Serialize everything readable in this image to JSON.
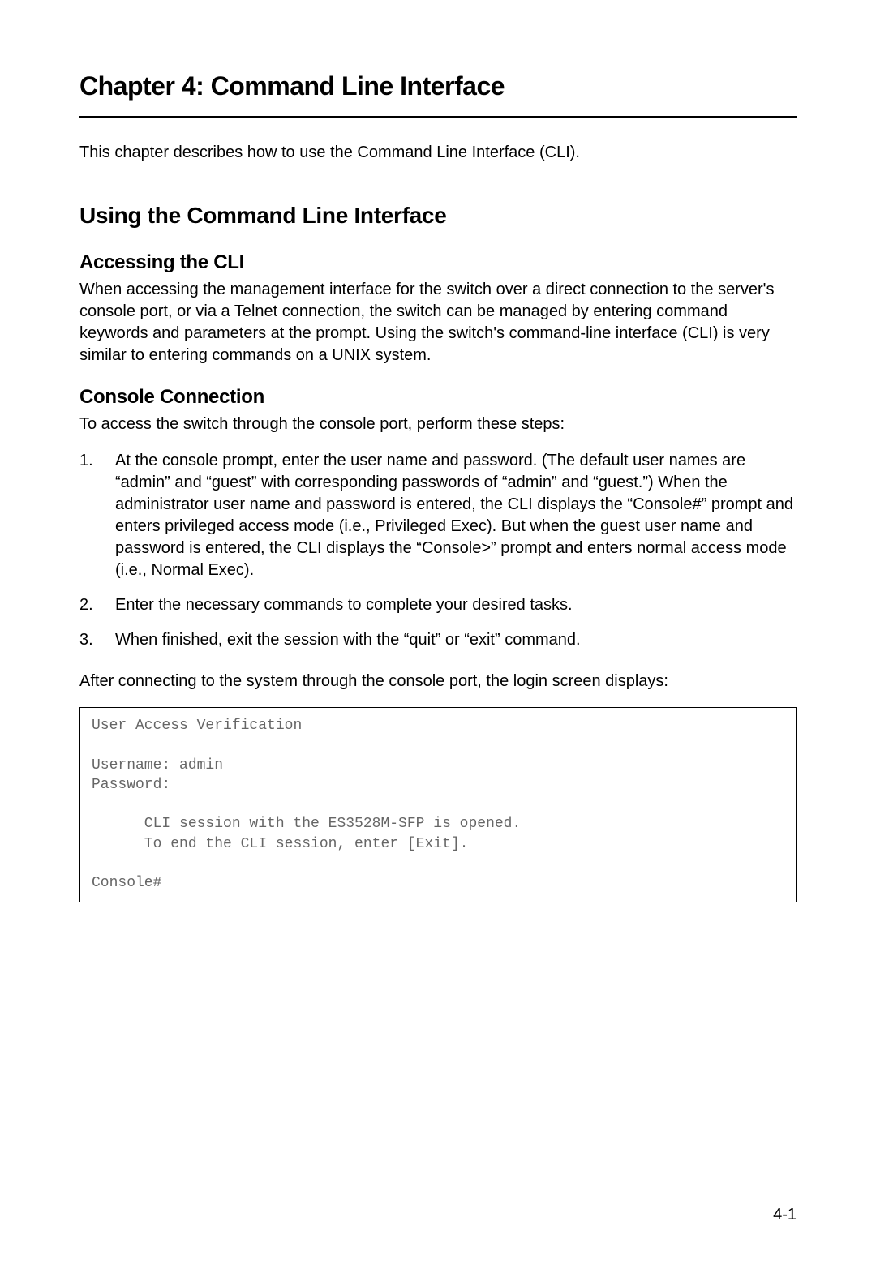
{
  "chapter_title": "Chapter 4: Command Line Interface",
  "intro": "This chapter describes how to use the Command Line Interface (CLI).",
  "section1": {
    "title": "Using the Command Line Interface",
    "sub1": {
      "title": "Accessing the CLI",
      "body": "When accessing the management interface for the switch over a direct connection to the server's console port, or via a Telnet connection, the switch can be managed by entering command keywords and parameters at the prompt. Using the switch's command-line interface (CLI) is very similar to entering commands on a UNIX system."
    },
    "sub2": {
      "title": "Console Connection",
      "intro": "To access the switch through the console port, perform these steps:",
      "steps": [
        "At the console prompt, enter the user name and password. (The default user names are “admin” and “guest” with corresponding passwords of “admin” and “guest.”) When the administrator user name and password is entered, the CLI displays the “Console#” prompt and enters privileged access mode (i.e., Privileged Exec). But when the guest user name and password is entered, the CLI displays the “Console>” prompt and enters normal access mode (i.e., Normal Exec).",
        "Enter the necessary commands to complete your desired tasks.",
        "When finished, exit the session with the “quit” or “exit” command."
      ],
      "after_steps": "After connecting to the system through the console port, the login screen displays:",
      "code": "User Access Verification\n\nUsername: admin\nPassword:\n\n      CLI session with the ES3528M-SFP is opened.\n      To end the CLI session, enter [Exit].\n\nConsole#"
    }
  },
  "page_number": "4-1"
}
